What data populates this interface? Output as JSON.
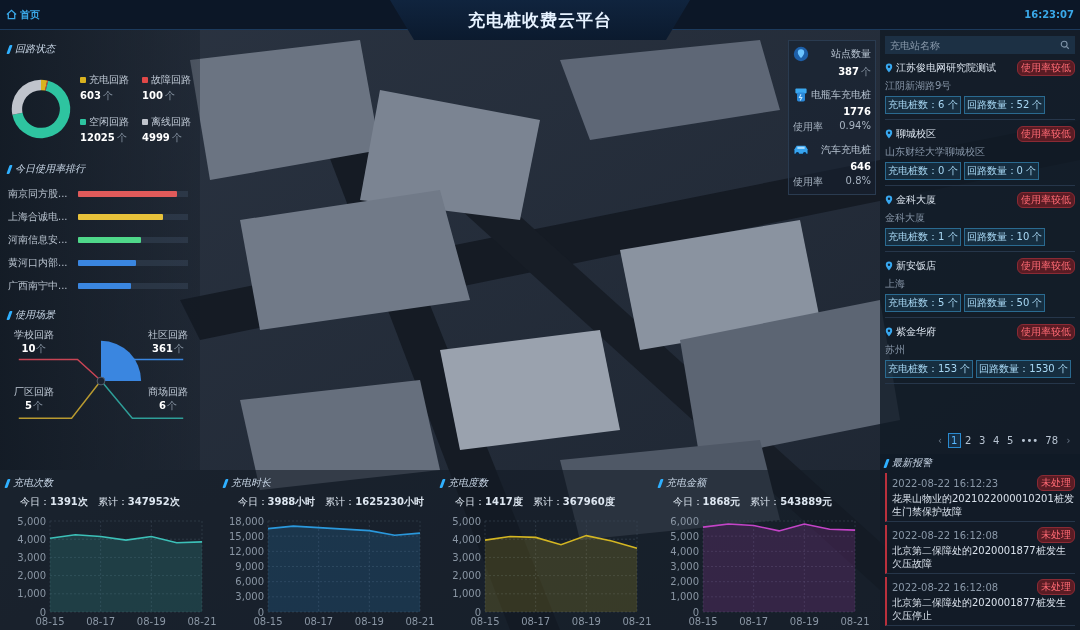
{
  "header": {
    "home": "首页",
    "title": "充电桩收费云平台",
    "time": "16:23:07"
  },
  "circuit_status": {
    "title": "回路状态",
    "items": [
      {
        "label": "充电回路",
        "value": "603",
        "unit": "个",
        "color": "#d9b21f"
      },
      {
        "label": "故障回路",
        "value": "100",
        "unit": "个",
        "color": "#e04848"
      },
      {
        "label": "空闲回路",
        "value": "12025",
        "unit": "个",
        "color": "#2ec4a0"
      },
      {
        "label": "离线回路",
        "value": "4999",
        "unit": "个",
        "color": "#c0c4cc"
      }
    ]
  },
  "ranking": {
    "title": "今日使用率排行",
    "items": [
      {
        "label": "南京同方股...",
        "level": 0.9,
        "color": "#e05a5a"
      },
      {
        "label": "上海合诚电...",
        "level": 0.77,
        "color": "#e8c23a"
      },
      {
        "label": "河南信息安...",
        "level": 0.57,
        "color": "#4fd88a"
      },
      {
        "label": "黄河口内部...",
        "level": 0.53,
        "color": "#3a86e0"
      },
      {
        "label": "广西南宁中...",
        "level": 0.48,
        "color": "#3a86e0"
      }
    ]
  },
  "scenario": {
    "title": "使用场景",
    "items": [
      {
        "label": "学校回路",
        "value": "10",
        "unit": "个",
        "color": "#c84454"
      },
      {
        "label": "社区回路",
        "value": "361",
        "unit": "个",
        "color": "#3a86e0"
      },
      {
        "label": "厂区回路",
        "value": "5",
        "unit": "个",
        "color": "#b89a30"
      },
      {
        "label": "商场回路",
        "value": "6",
        "unit": "个",
        "color": "#2e9e98"
      }
    ]
  },
  "stats": [
    {
      "kind": "site",
      "label": "站点数量",
      "value": "387",
      "unit": "个"
    },
    {
      "kind": "ebike",
      "label": "电瓶车充电桩",
      "value": "1776",
      "rate_label": "使用率",
      "rate": "0.94%"
    },
    {
      "kind": "car",
      "label": "汽车充电桩",
      "value": "646",
      "rate_label": "使用率",
      "rate": "0.8%"
    }
  ],
  "stations": {
    "search": {
      "placeholder": "充电站名称"
    },
    "items": [
      {
        "name": "江苏俊电网研究院测试",
        "address": "江阴新湖路9号",
        "status": "使用率较低",
        "piles": "充电桩数：6 个",
        "circuits": "回路数量：52 个"
      },
      {
        "name": "聊城校区",
        "address": "山东财经大学聊城校区",
        "status": "使用率较低",
        "piles": "充电桩数：0 个",
        "circuits": "回路数量：0 个"
      },
      {
        "name": "金科大厦",
        "address": "金科大厦",
        "status": "使用率较低",
        "piles": "充电桩数：1 个",
        "circuits": "回路数量：10 个"
      },
      {
        "name": "新安饭店",
        "address": "上海",
        "status": "使用率较低",
        "piles": "充电桩数：5 个",
        "circuits": "回路数量：50 个"
      },
      {
        "name": "紫金华府",
        "address": "苏州",
        "status": "使用率较低",
        "piles": "充电桩数：153 个",
        "circuits": "回路数量：1530 个"
      }
    ],
    "pagination": {
      "prev": "‹",
      "next": "›",
      "pages": [
        {
          "label": "1",
          "selected": true
        },
        {
          "label": "2",
          "selected": false
        },
        {
          "label": "3",
          "selected": false
        },
        {
          "label": "4",
          "selected": false
        },
        {
          "label": "5",
          "selected": false
        },
        {
          "label": "•••",
          "selected": false
        },
        {
          "label": "78",
          "selected": false
        }
      ]
    }
  },
  "alarms": {
    "title": "最新报警",
    "items": [
      {
        "time": "2022-08-22 16:12:23",
        "text": "花果山物业的2021022000010201桩发生门禁保护故障",
        "status": "未处理"
      },
      {
        "time": "2022-08-22 16:12:08",
        "text": "北京第二保障处的2020001877桩发生欠压故障",
        "status": "未处理"
      },
      {
        "time": "2022-08-22 16:12:08",
        "text": "北京第二保障处的2020001877桩发生欠压停止",
        "status": "未处理"
      }
    ]
  },
  "charts": [
    {
      "title": "充电次数",
      "today": "今日：**1391次**",
      "total": "累计：**347952次**",
      "chart_data": {
        "type": "area",
        "grid": true,
        "categories": [
          "08-15",
          null,
          "08-17",
          null,
          "08-19",
          null,
          "08-21"
        ],
        "ylim": [
          0,
          5000
        ],
        "yticks": [
          {
            "value": 0,
            "label": "0"
          },
          {
            "value": 1000,
            "label": "1,000"
          },
          {
            "value": 2000,
            "label": "2,000"
          },
          {
            "value": 3000,
            "label": "3,000"
          },
          {
            "value": 4000,
            "label": "4,000"
          },
          {
            "value": 5000,
            "label": "5,000"
          }
        ],
        "series": [
          {
            "color": "#3cc0b8",
            "values": [
              4050,
              4250,
              4150,
              3950,
              4150,
              3800,
              3850
            ]
          }
        ]
      }
    },
    {
      "title": "充电时长",
      "today": "今日：**3988小时**",
      "total": "累计：**1625230小时**",
      "chart_data": {
        "type": "area",
        "grid": true,
        "categories": [
          "08-15",
          null,
          "08-17",
          null,
          "08-19",
          null,
          "08-21"
        ],
        "ylim": [
          0,
          18000
        ],
        "yticks": [
          {
            "value": 0,
            "label": "0"
          },
          {
            "value": 3000,
            "label": "3,000"
          },
          {
            "value": 6000,
            "label": "6,000"
          },
          {
            "value": 9000,
            "label": "9,000"
          },
          {
            "value": 12000,
            "label": "12,000"
          },
          {
            "value": 15000,
            "label": "15,000"
          },
          {
            "value": 18000,
            "label": "18,000"
          }
        ],
        "series": [
          {
            "color": "#2a98dc",
            "values": [
              16500,
              17000,
              16700,
              16400,
              16100,
              15200,
              15600
            ]
          }
        ]
      }
    },
    {
      "title": "充电度数",
      "today": "今日：**1417度**",
      "total": "累计：**367960度**",
      "chart_data": {
        "type": "area",
        "grid": true,
        "categories": [
          "08-15",
          null,
          "08-17",
          null,
          "08-19",
          null,
          "08-21"
        ],
        "ylim": [
          0,
          5000
        ],
        "yticks": [
          {
            "value": 0,
            "label": "0"
          },
          {
            "value": 1000,
            "label": "1,000"
          },
          {
            "value": 2000,
            "label": "2,000"
          },
          {
            "value": 3000,
            "label": "3,000"
          },
          {
            "value": 4000,
            "label": "4,000"
          },
          {
            "value": 5000,
            "label": "5,000"
          }
        ],
        "series": [
          {
            "color": "#d4b622",
            "values": [
              3950,
              4150,
              4100,
              3700,
              4200,
              3900,
              3500
            ]
          }
        ]
      }
    },
    {
      "title": "充电金额",
      "today": "今日：**1868元**",
      "total": "累计：**543889元**",
      "chart_data": {
        "type": "area",
        "grid": true,
        "categories": [
          "08-15",
          null,
          "08-17",
          null,
          "08-19",
          null,
          "08-21"
        ],
        "ylim": [
          0,
          6000
        ],
        "yticks": [
          {
            "value": 0,
            "label": "0"
          },
          {
            "value": 1000,
            "label": "1,000"
          },
          {
            "value": 2000,
            "label": "2,000"
          },
          {
            "value": 3000,
            "label": "3,000"
          },
          {
            "value": 4000,
            "label": "4,000"
          },
          {
            "value": 5000,
            "label": "5,000"
          },
          {
            "value": 6000,
            "label": "6,000"
          }
        ],
        "series": [
          {
            "color": "#c444c8",
            "values": [
              5600,
              5800,
              5700,
              5350,
              5800,
              5450,
              5400
            ]
          }
        ]
      }
    }
  ]
}
